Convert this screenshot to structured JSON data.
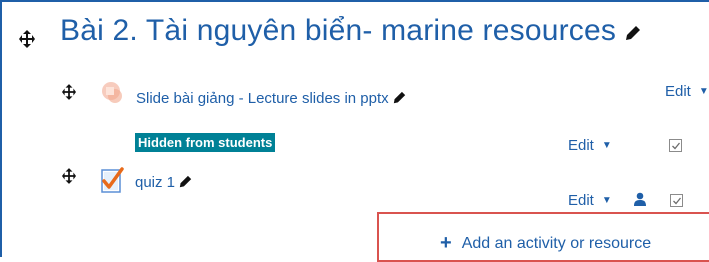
{
  "section": {
    "title": "Bài 2. Tài nguyên biển- marine resources"
  },
  "activities": [
    {
      "title": "Slide bài giảng - Lecture slides in pptx",
      "edit_label": "Edit"
    },
    {
      "badge": "Hidden from students",
      "edit_label": "Edit"
    },
    {
      "title": "quiz 1",
      "edit_label": "Edit"
    }
  ],
  "add_activity": {
    "label": "Add an activity or resource"
  },
  "colors": {
    "link": "#1f5fa8",
    "badge_bg": "#008196",
    "highlight_border": "#d9534f"
  }
}
